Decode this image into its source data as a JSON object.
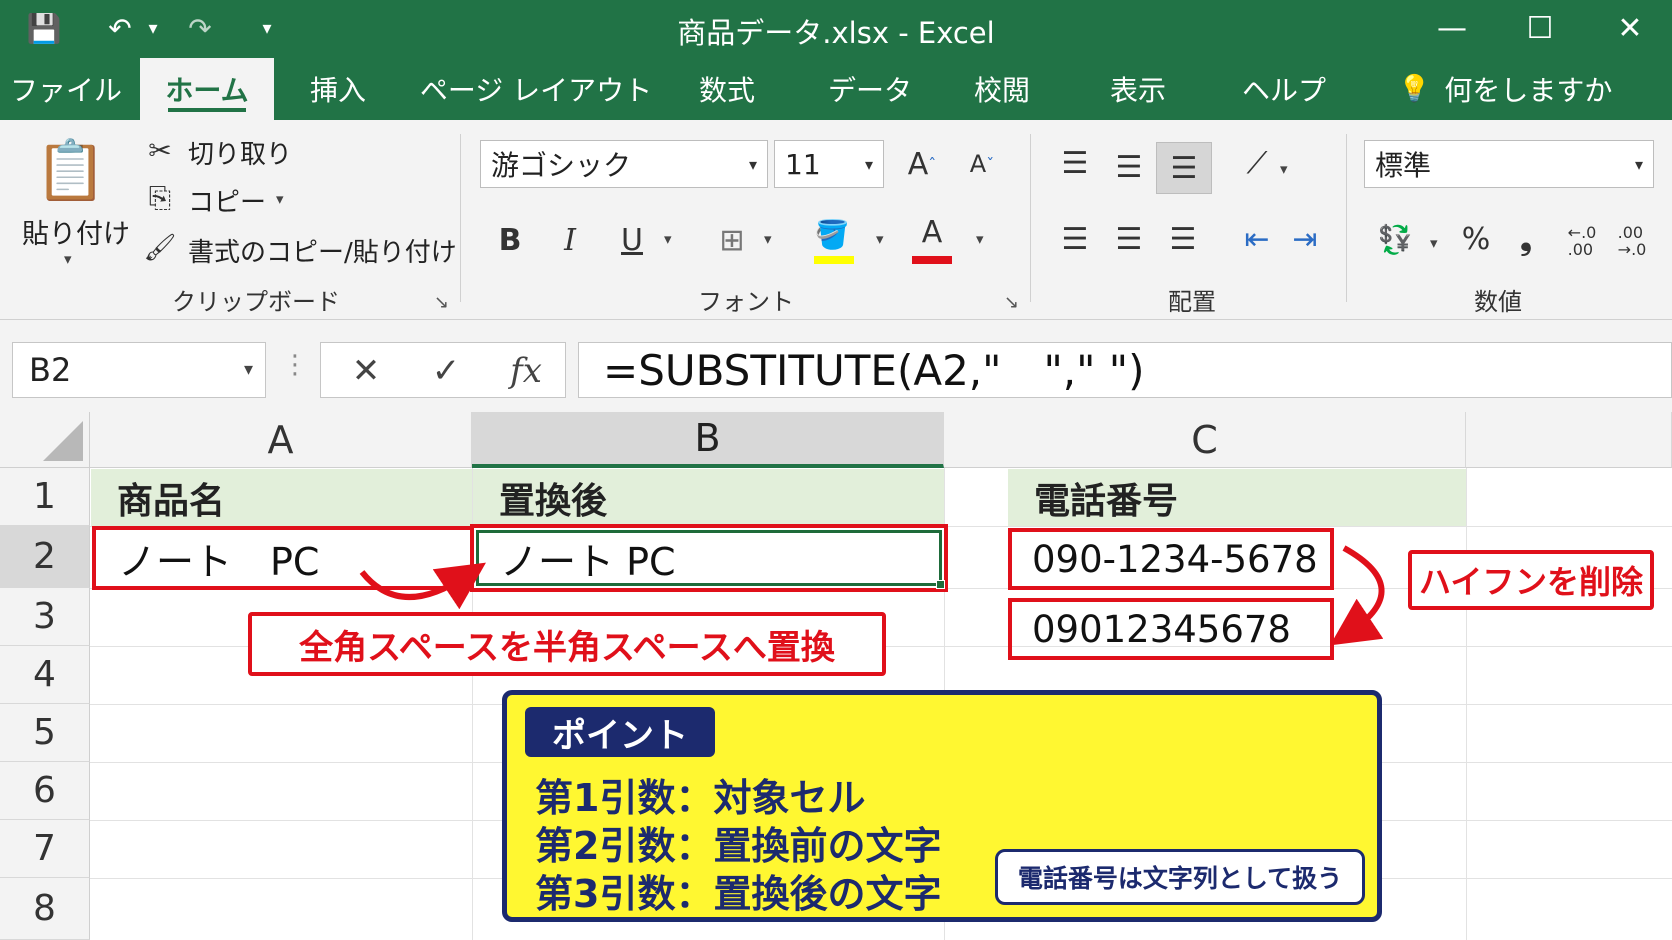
{
  "window": {
    "title": "商品データ.xlsx  -  Excel",
    "qat": {
      "save": "💾",
      "undo": "↶",
      "undo_dd": "▾",
      "redo": "↷",
      "customize": "▾"
    },
    "controls": {
      "minimize": "—",
      "maximize": "☐",
      "close": "✕"
    }
  },
  "tabs": [
    "ファイル",
    "ホーム",
    "挿入",
    "ページ レイアウト",
    "数式",
    "データ",
    "校閲",
    "表示",
    "ヘルプ"
  ],
  "active_tab": "ホーム",
  "tell_me": {
    "icon": "lightbulb-icon",
    "glyph": "💡",
    "text": "何をしますか"
  },
  "ribbon": {
    "clipboard": {
      "paste": "貼り付け",
      "cut": "切り取り",
      "copy": "コピー",
      "format_painter": "書式のコピー/貼り付け",
      "label": "クリップボード",
      "glyphs": {
        "paste": "📋",
        "cut": "✂",
        "copy": "⎘",
        "painter": "🖌",
        "caret": "▾",
        "launcher": "↘"
      }
    },
    "font": {
      "name": "游ゴシック",
      "size": "11",
      "label": "フォント",
      "glyphs": {
        "combo_caret": "▾",
        "grow": "A",
        "grow_sup": "ˆ",
        "shrink": "A",
        "shrink_sup": "ˇ",
        "bold": "B",
        "italic": "I",
        "underline": "U",
        "border": "⊞",
        "fill": "🪣",
        "color": "A",
        "caret": "▾",
        "launcher": "↘"
      }
    },
    "alignment": {
      "label": "配置",
      "glyphs": {
        "lines": "☰",
        "orientation": "⟋",
        "indent_dec": "⇤",
        "indent_inc": "⇥",
        "caret": "▾"
      }
    },
    "number": {
      "format": "標準",
      "label": "数値",
      "glyphs": {
        "combo_caret": "▾",
        "accounting": "💱",
        "caret": "▾",
        "percent": "%",
        "comma": "❟",
        "inc_decimal": "←.0\n.00",
        "dec_decimal": ".00\n→.0"
      }
    }
  },
  "formula_bar": {
    "name_box": "B2",
    "name_box_caret": "▾",
    "splitter": "⋮",
    "cancel": "✕",
    "enter": "✓",
    "fx": "fx",
    "formula": "=SUBSTITUTE(A2,\"　\",\" \")"
  },
  "grid": {
    "columns": [
      "A",
      "B",
      "C"
    ],
    "rows": [
      "1",
      "2",
      "3",
      "4",
      "5",
      "6",
      "7",
      "8"
    ],
    "headers": {
      "A1": "商品名",
      "B1": "置換後",
      "C1": "電話番号"
    },
    "cells": {
      "A2": "ノート　PC",
      "B2": "ノート PC",
      "C2": "090-1234-5678",
      "C3": "09012345678"
    }
  },
  "annotations": {
    "space_callout": "全角スペースを半角スペースへ置換",
    "hyphen_callout": "ハイフンを削除",
    "point_title": "ポイント",
    "point_lines": [
      "第1引数：対象セル",
      "第2引数：置換前の文字",
      "第3引数：置換後の文字"
    ],
    "point_note": "電話番号は文字列として扱う",
    "accent_red": "#e0101a",
    "accent_navy": "#1c2a6e",
    "point_bg": "#fff731"
  }
}
